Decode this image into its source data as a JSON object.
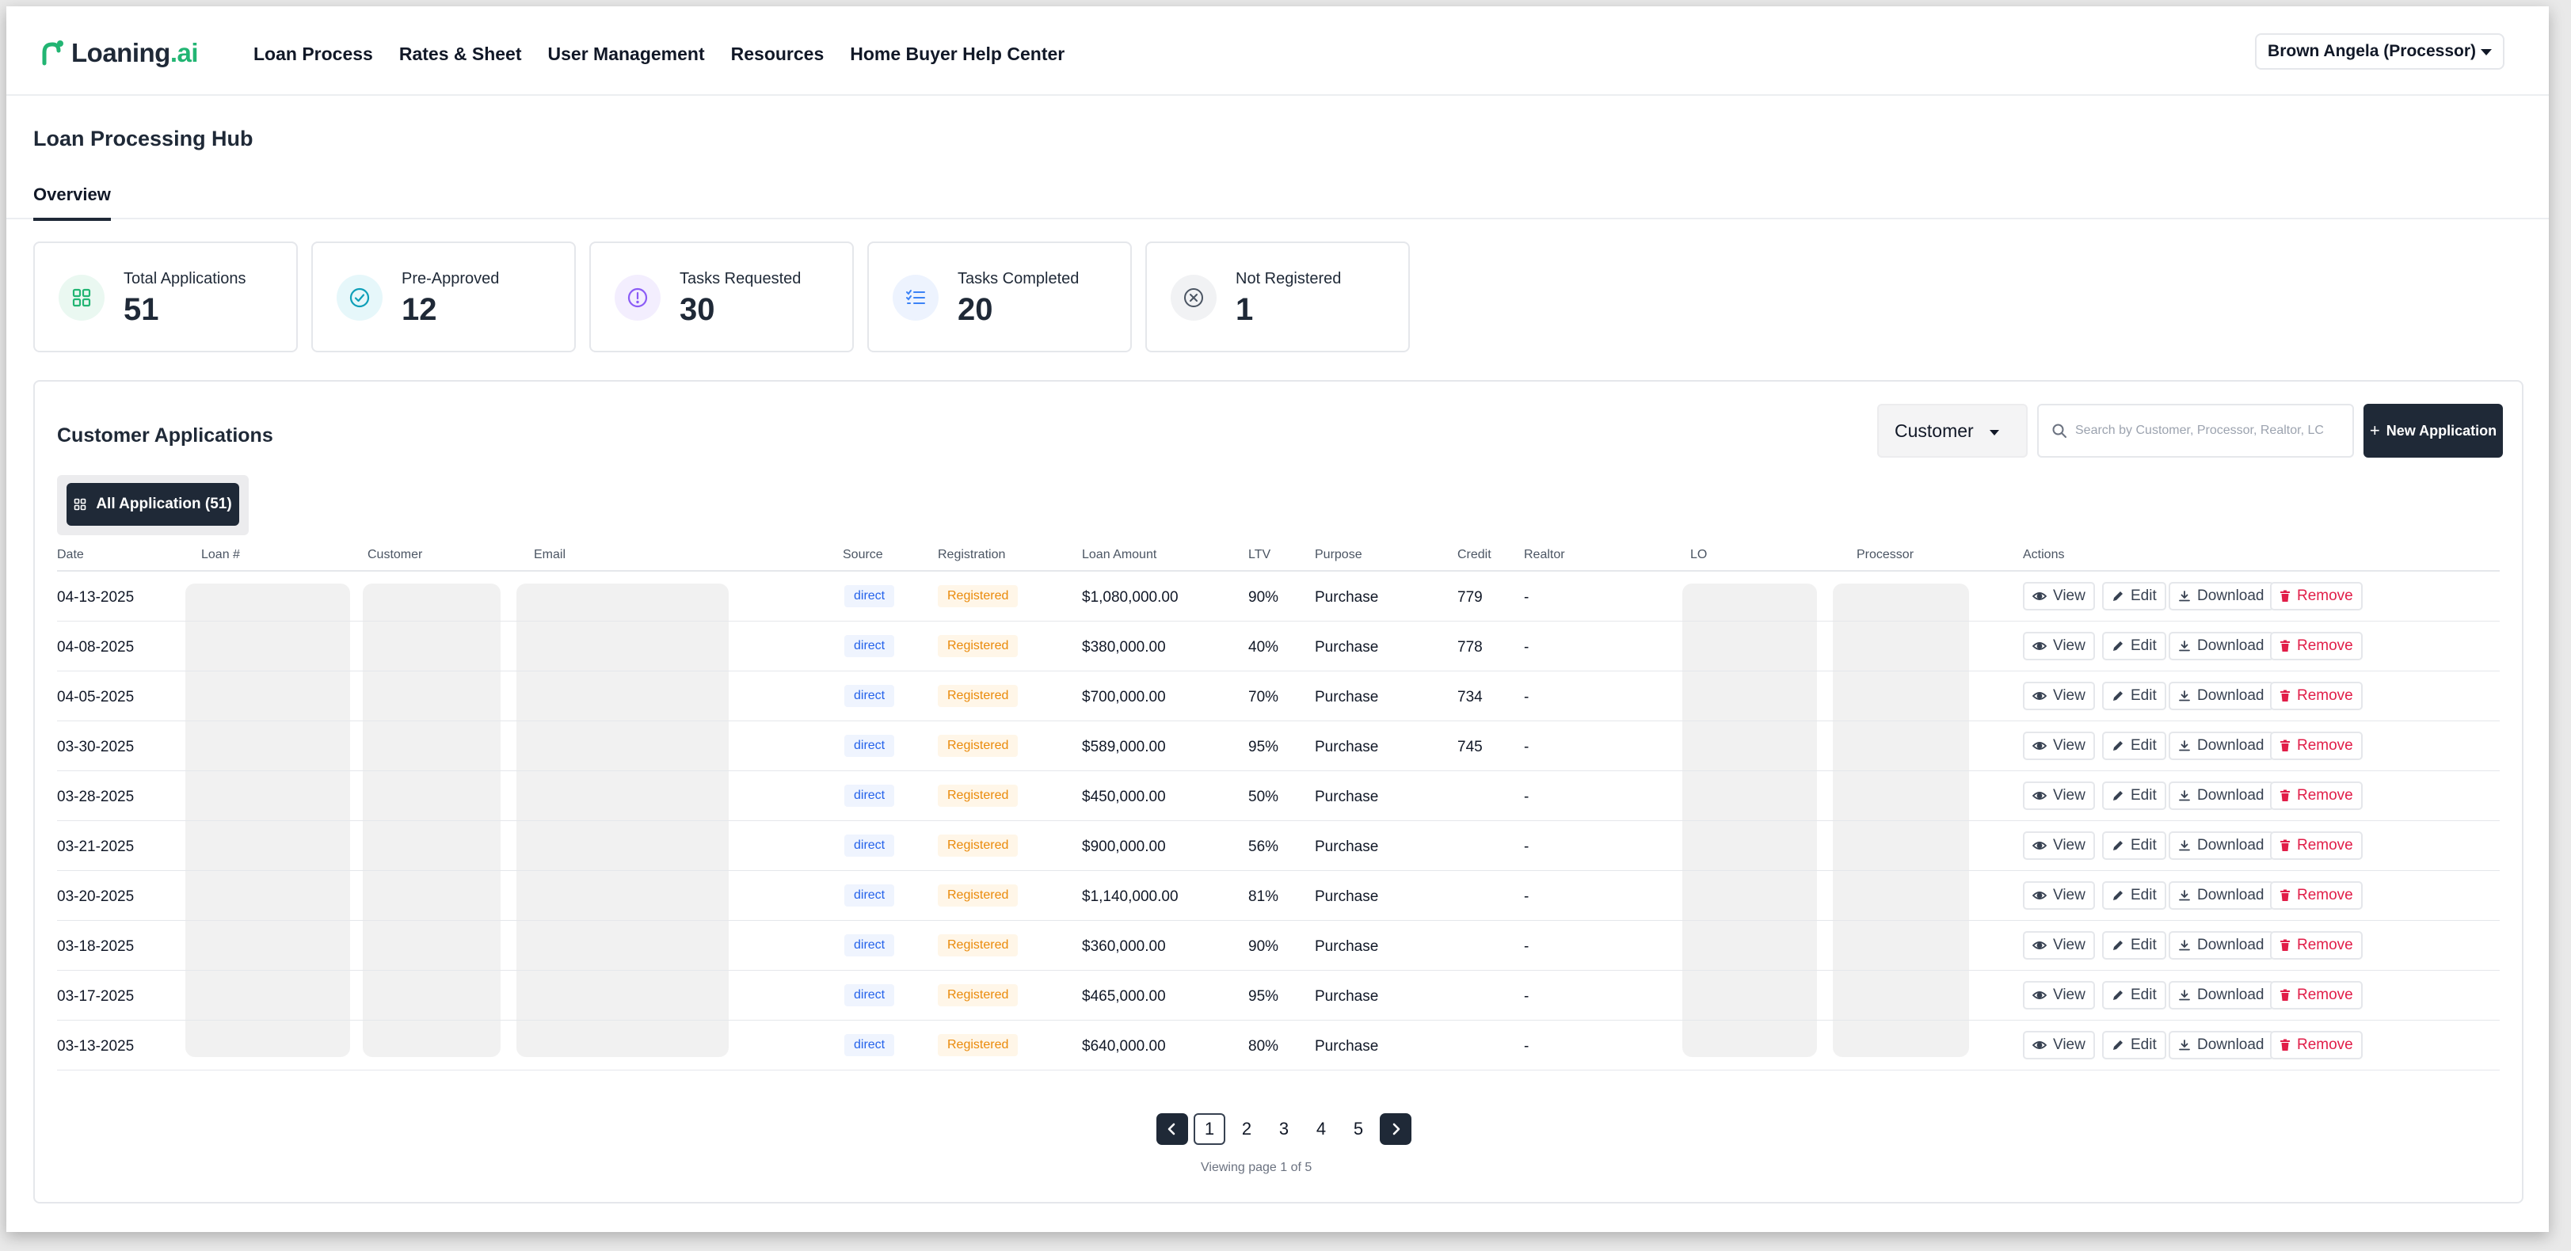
{
  "app": {
    "logo": {
      "main": "Loaning",
      "accent": ".ai"
    },
    "nav": [
      "Loan Process",
      "Rates & Sheet",
      "User Management",
      "Resources",
      "Home Buyer Help Center"
    ],
    "user": "Brown Angela (Processor)"
  },
  "page": {
    "title": "Loan Processing Hub",
    "tab": "Overview"
  },
  "stats": [
    {
      "label": "Total Applications",
      "value": "51",
      "icon": "grid-icon",
      "color": "#22b573"
    },
    {
      "label": "Pre-Approved",
      "value": "12",
      "icon": "check-circle-icon",
      "color": "#0e9fb8"
    },
    {
      "label": "Tasks Requested",
      "value": "30",
      "icon": "alert-circle-icon",
      "color": "#8b5cf6"
    },
    {
      "label": "Tasks Completed",
      "value": "20",
      "icon": "list-check-icon",
      "color": "#3b82f6"
    },
    {
      "label": "Not Registered",
      "value": "1",
      "icon": "x-circle-icon",
      "color": "#6b7280"
    }
  ],
  "applications": {
    "title": "Customer Applications",
    "filter_value": "Customer",
    "search_placeholder": "Search by Customer, Processor, Realtor, LC",
    "new_button": "New Application",
    "all_button": "All Application (51)",
    "columns": [
      "Date",
      "Loan #",
      "Customer",
      "Email",
      "Source",
      "Registration",
      "Loan Amount",
      "LTV",
      "Purpose",
      "Credit",
      "Realtor",
      "LO",
      "Processor",
      "Actions"
    ],
    "rows": [
      {
        "date": "04-13-2025",
        "source": "direct",
        "registration": "Registered",
        "amount": "$1,080,000.00",
        "ltv": "90%",
        "purpose": "Purchase",
        "credit": "779",
        "realtor": "-"
      },
      {
        "date": "04-08-2025",
        "source": "direct",
        "registration": "Registered",
        "amount": "$380,000.00",
        "ltv": "40%",
        "purpose": "Purchase",
        "credit": "778",
        "realtor": "-"
      },
      {
        "date": "04-05-2025",
        "source": "direct",
        "registration": "Registered",
        "amount": "$700,000.00",
        "ltv": "70%",
        "purpose": "Purchase",
        "credit": "734",
        "realtor": "-"
      },
      {
        "date": "03-30-2025",
        "source": "direct",
        "registration": "Registered",
        "amount": "$589,000.00",
        "ltv": "95%",
        "purpose": "Purchase",
        "credit": "745",
        "realtor": "-"
      },
      {
        "date": "03-28-2025",
        "source": "direct",
        "registration": "Registered",
        "amount": "$450,000.00",
        "ltv": "50%",
        "purpose": "Purchase",
        "credit": "",
        "realtor": "-"
      },
      {
        "date": "03-21-2025",
        "source": "direct",
        "registration": "Registered",
        "amount": "$900,000.00",
        "ltv": "56%",
        "purpose": "Purchase",
        "credit": "",
        "realtor": "-"
      },
      {
        "date": "03-20-2025",
        "source": "direct",
        "registration": "Registered",
        "amount": "$1,140,000.00",
        "ltv": "81%",
        "purpose": "Purchase",
        "credit": "",
        "realtor": "-"
      },
      {
        "date": "03-18-2025",
        "source": "direct",
        "registration": "Registered",
        "amount": "$360,000.00",
        "ltv": "90%",
        "purpose": "Purchase",
        "credit": "",
        "realtor": "-"
      },
      {
        "date": "03-17-2025",
        "source": "direct",
        "registration": "Registered",
        "amount": "$465,000.00",
        "ltv": "95%",
        "purpose": "Purchase",
        "credit": "",
        "realtor": "-"
      },
      {
        "date": "03-13-2025",
        "source": "direct",
        "registration": "Registered",
        "amount": "$640,000.00",
        "ltv": "80%",
        "purpose": "Purchase",
        "credit": "",
        "realtor": "-"
      }
    ],
    "actions": {
      "view": "View",
      "edit": "Edit",
      "download": "Download",
      "remove": "Remove"
    },
    "pagination": {
      "pages": [
        "1",
        "2",
        "3",
        "4",
        "5"
      ],
      "current": "1",
      "status": "Viewing page 1 of 5"
    }
  }
}
